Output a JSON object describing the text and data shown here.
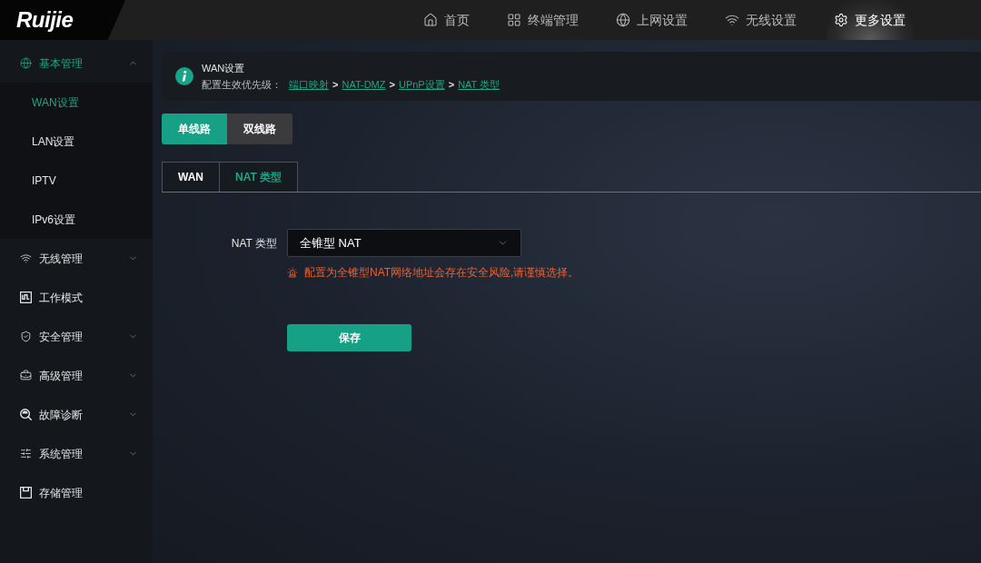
{
  "header": {
    "logo": "Ruijie",
    "nav": [
      {
        "label": "首页",
        "selected": false
      },
      {
        "label": "终端管理",
        "selected": false
      },
      {
        "label": "上网设置",
        "selected": false
      },
      {
        "label": "无线设置",
        "selected": false
      },
      {
        "label": "更多设置",
        "selected": true
      }
    ]
  },
  "sidebar": {
    "items": [
      {
        "kind": "group",
        "label": "基本管理",
        "selected": true,
        "expanded": true,
        "children": [
          {
            "label": "WAN设置",
            "selected": true
          },
          {
            "label": "LAN设置",
            "selected": false
          },
          {
            "label": "IPTV",
            "selected": false
          },
          {
            "label": "IPv6设置",
            "selected": false
          }
        ]
      },
      {
        "kind": "group",
        "label": "无线管理",
        "selected": false,
        "expanded": false
      },
      {
        "kind": "page",
        "label": "工作模式",
        "selected": false
      },
      {
        "kind": "group",
        "label": "安全管理",
        "selected": false,
        "expanded": false
      },
      {
        "kind": "group",
        "label": "高级管理",
        "selected": false,
        "expanded": false
      },
      {
        "kind": "group",
        "label": "故障诊断",
        "selected": false,
        "expanded": false
      },
      {
        "kind": "group",
        "label": "系统管理",
        "selected": false,
        "expanded": false
      },
      {
        "kind": "page",
        "label": "存储管理",
        "selected": false
      }
    ]
  },
  "banner": {
    "title": "WAN设置",
    "priority_label": "配置生效优先级：",
    "chain": [
      {
        "kind": "link",
        "text": "端口映射"
      },
      {
        "kind": "separator",
        "text": ">"
      },
      {
        "kind": "link",
        "text": "NAT-DMZ"
      },
      {
        "kind": "separator",
        "text": ">"
      },
      {
        "kind": "link",
        "text": "UPnP设置"
      },
      {
        "kind": "separator",
        "text": ">"
      },
      {
        "kind": "link",
        "text": "NAT 类型"
      }
    ]
  },
  "line_modes": [
    {
      "label": "单线路",
      "selected": true
    },
    {
      "label": "双线路",
      "selected": false
    }
  ],
  "tabs": [
    {
      "label": "WAN",
      "selected": false
    },
    {
      "label": "NAT 类型",
      "selected": true
    }
  ],
  "form": {
    "field_label": "NAT 类型",
    "select_value": "全锥型 NAT",
    "warning": "配置为全锥型NAT网络地址会存在安全风险,请谨慎选择。",
    "save_button": "保存"
  }
}
